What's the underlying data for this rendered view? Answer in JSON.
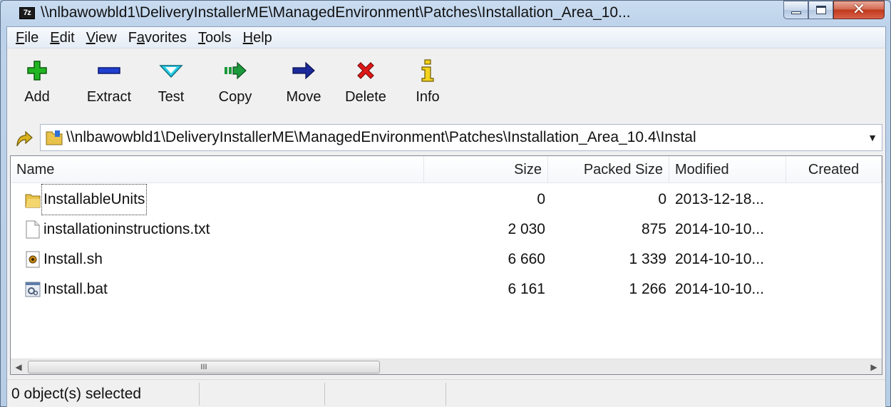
{
  "window": {
    "title": "\\\\nlbawowbld1\\DeliveryInstallerME\\ManagedEnvironment\\Patches\\Installation_Area_10...",
    "app_icon_text": "7z"
  },
  "menu": [
    {
      "label": "File",
      "accel": "F",
      "rest": "ile"
    },
    {
      "label": "Edit",
      "accel": "E",
      "rest": "dit"
    },
    {
      "label": "View",
      "accel": "V",
      "rest": "iew"
    },
    {
      "label": "Favorites",
      "pre": "F",
      "accel": "a",
      "rest": "vorites"
    },
    {
      "label": "Tools",
      "accel": "T",
      "rest": "ools"
    },
    {
      "label": "Help",
      "accel": "H",
      "rest": "elp"
    }
  ],
  "toolbar": {
    "add": "Add",
    "extract": "Extract",
    "test": "Test",
    "copy": "Copy",
    "move": "Move",
    "delete": "Delete",
    "info": "Info"
  },
  "address": {
    "path": "\\\\nlbawowbld1\\DeliveryInstallerME\\ManagedEnvironment\\Patches\\Installation_Area_10.4\\Instal"
  },
  "columns": {
    "name": "Name",
    "size": "Size",
    "packed": "Packed Size",
    "modified": "Modified",
    "created": "Created"
  },
  "files": [
    {
      "name": "InstallableUnits",
      "size": "0",
      "packed": "0",
      "modified": "2013-12-18...",
      "icon": "folder-icon"
    },
    {
      "name": "installationinstructions.txt",
      "size": "2 030",
      "packed": "875",
      "modified": "2014-10-10...",
      "icon": "text-file-icon"
    },
    {
      "name": "Install.sh",
      "size": "6 660",
      "packed": "1 339",
      "modified": "2014-10-10...",
      "icon": "script-file-icon"
    },
    {
      "name": "Install.bat",
      "size": "6 161",
      "packed": "1 266",
      "modified": "2014-10-10...",
      "icon": "batch-file-icon"
    }
  ],
  "scrollbar": {
    "grip": "III"
  },
  "status": {
    "selected": "0 object(s) selected"
  },
  "colors": {
    "add": "#22b522",
    "extract": "#1f3fd0",
    "test": "#2ad0e8",
    "copy": "#1c9a3c",
    "move": "#1b2a9a",
    "delete": "#e01818",
    "info": "#d4b000"
  }
}
